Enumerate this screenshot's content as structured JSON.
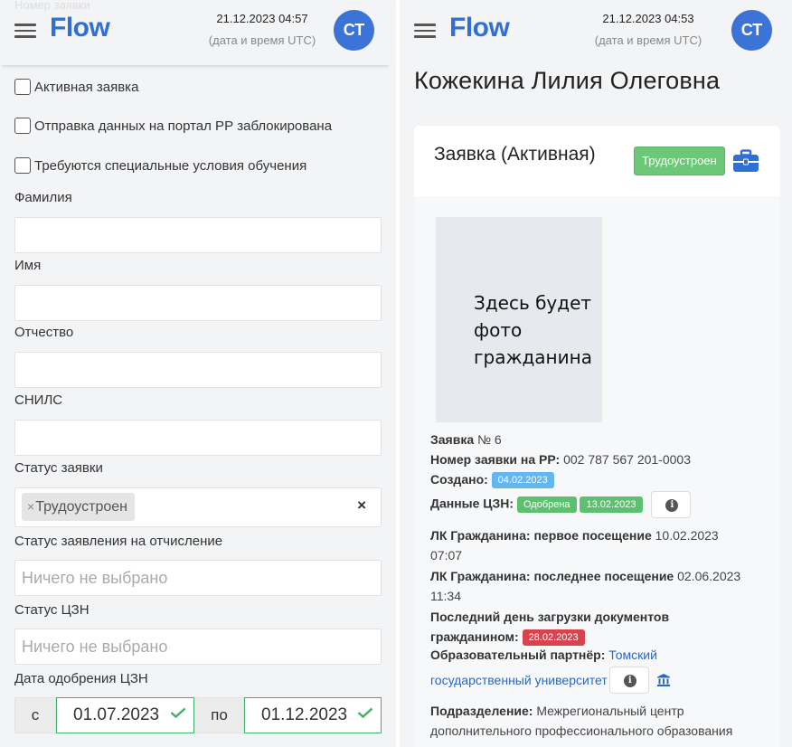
{
  "left": {
    "header": {
      "ghost_text": "Номер заявки",
      "brand": "Flow",
      "datetime": "21.12.2023 04:57",
      "datetime_note": "(дата и время UTC)",
      "avatar_initials": "СТ"
    },
    "checkboxes": [
      {
        "label": "Активная заявка",
        "checked": false
      },
      {
        "label": "Отправка данных на портал РР заблокирована",
        "checked": false
      },
      {
        "label": "Требуются специальные условия обучения",
        "checked": false
      }
    ],
    "fields": {
      "surname_label": "Фамилия",
      "surname_value": "",
      "name_label": "Имя",
      "name_value": "",
      "patronymic_label": "Отчество",
      "patronymic_value": "",
      "snils_label": "СНИЛС",
      "snils_value": "",
      "status_label": "Статус заявки",
      "status_tag": "Трудоустроен",
      "status_tag_remove": "×",
      "status_clear": "×",
      "expel_status_label": "Статус заявления на отчисление",
      "expel_status_placeholder": "Ничего не выбрано",
      "czn_status_label": "Статус ЦЗН",
      "czn_status_placeholder": "Ничего не выбрано",
      "czn_date_label": "Дата одобрения ЦЗН",
      "date_from_prefix": "с",
      "date_from": "01.07.2023",
      "date_to_prefix": "по",
      "date_to": "01.12.2023"
    }
  },
  "right": {
    "header": {
      "brand": "Flow",
      "datetime": "21.12.2023 04:53",
      "datetime_note": "(дата и время UTC)",
      "avatar_initials": "СТ"
    },
    "person_name": "Кожекина Лилия Олеговна",
    "card": {
      "title": "Заявка (Активная)",
      "status_badge": "Трудоустроен",
      "photo_placeholder": [
        "Здесь будет",
        "фото",
        "гражданина"
      ],
      "application_label": "Заявка",
      "application_number": "№ 6",
      "rr_number_label": "Номер заявки на РР:",
      "rr_number": "002 787 567 201-0003",
      "created_label": "Создано:",
      "created_date": "04.02.2023",
      "czn_label": "Данные ЦЗН:",
      "czn_status": "Одобрена",
      "czn_date": "13.02.2023",
      "first_visit_label": "ЛК Гражданина: первое посещение",
      "first_visit_date": "10.02.2023",
      "first_visit_time": "07:07",
      "last_visit_label": "ЛК Гражданина: последнее посещение",
      "last_visit_date": "02.06.2023",
      "last_visit_time": "11:34",
      "doc_deadline_label_1": "Последний день загрузки документов",
      "doc_deadline_label_2": "гражданином:",
      "doc_deadline_date": "28.02.2023",
      "partner_label": "Образовательный партнёр:",
      "partner_name_1": "Томский",
      "partner_name_2": "государственный университет",
      "division_label": "Подразделение:",
      "division_value_1": "Межрегиональный центр",
      "division_value_2": "дополнительного профессионального образования"
    }
  },
  "colors": {
    "brand": "#2f6fd6",
    "avatar": "#3b73d6",
    "badge_green": "#6cc777",
    "pill_blue": "#64b7ee",
    "pill_red": "#d8434e",
    "date_border": "#46b06a",
    "link": "#2b67c2"
  },
  "icons": [
    "menu-icon",
    "briefcase-icon",
    "info-icon",
    "institution-icon",
    "check-icon"
  ]
}
